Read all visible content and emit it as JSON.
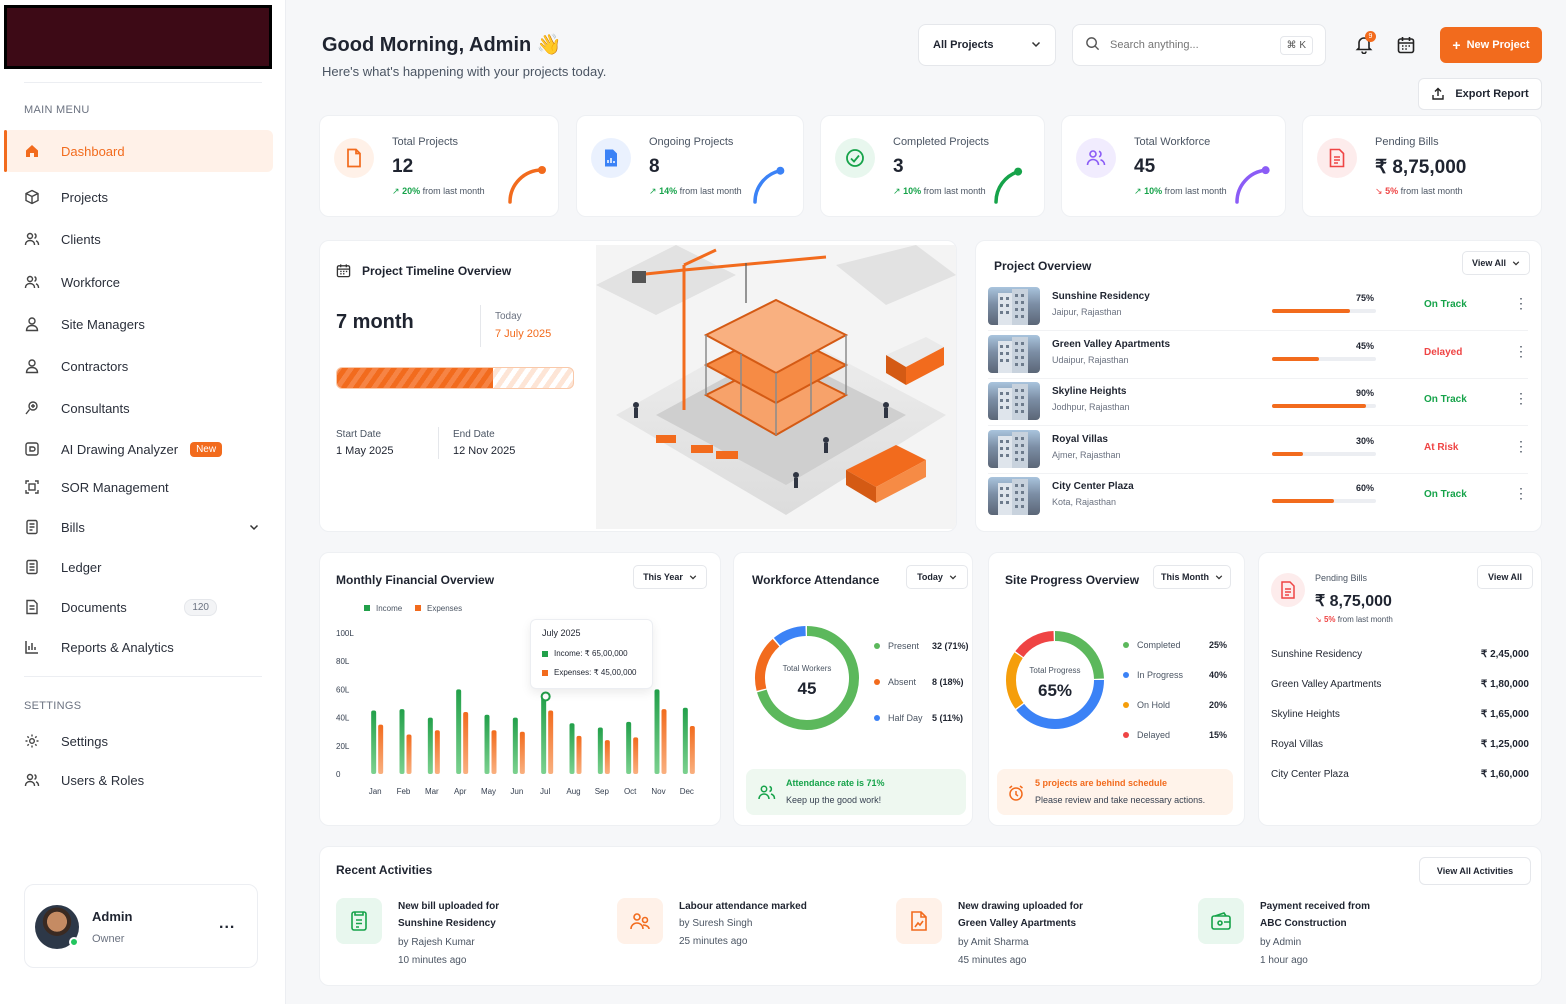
{
  "colors": {
    "accent": "#f26b1d",
    "green": "#16a34a",
    "red": "#ef4444",
    "blue": "#3b82f6",
    "purple": "#8b5cf6"
  },
  "sidebar": {
    "main_menu": "MAIN MENU",
    "settings_title": "SETTINGS",
    "items": [
      {
        "label": "Dashboard",
        "icon": "home-icon"
      },
      {
        "label": "Projects",
        "icon": "cube-icon"
      },
      {
        "label": "Clients",
        "icon": "users-icon"
      },
      {
        "label": "Workforce",
        "icon": "team-icon"
      },
      {
        "label": "Site Managers",
        "icon": "user-icon"
      },
      {
        "label": "Contractors",
        "icon": "user-icon"
      },
      {
        "label": "Consultants",
        "icon": "consultant-icon"
      },
      {
        "label": "AI Drawing Analyzer",
        "icon": "ai-icon",
        "badge": "New"
      },
      {
        "label": "SOR Management",
        "icon": "sor-icon"
      },
      {
        "label": "Bills",
        "icon": "bill-icon"
      },
      {
        "label": "Ledger",
        "icon": "ledger-icon"
      },
      {
        "label": "Documents",
        "icon": "document-icon",
        "count": "120"
      },
      {
        "label": "Reports & Analytics",
        "icon": "chart-icon"
      }
    ],
    "settings_items": [
      {
        "label": "Settings",
        "icon": "gear-icon"
      },
      {
        "label": "Users & Roles",
        "icon": "users-icon"
      }
    ],
    "user": {
      "name": "Admin",
      "role": "Owner",
      "more": "..."
    }
  },
  "header": {
    "greeting": "Good Morning, Admin 👋",
    "subtitle": "Here's what's happening with your projects today.",
    "project_select": "All Projects",
    "search_placeholder": "Search anything...",
    "search_shortcut": "⌘ K",
    "notif_count": "9",
    "new_project": "New Project",
    "export": "Export Report"
  },
  "kpis": [
    {
      "label": "Total Projects",
      "value": "12",
      "trend": "20%",
      "trend_text": "from last month",
      "dir": "up",
      "color": "#f26b1d",
      "bg": "#fff1e8",
      "icon": "file-icon",
      "arc": 0.75
    },
    {
      "label": "Ongoing Projects",
      "value": "8",
      "trend": "14%",
      "trend_text": "from last month",
      "dir": "up",
      "color": "#3b82f6",
      "bg": "#eaf1fe",
      "icon": "doc-chart-icon",
      "arc": 0.65
    },
    {
      "label": "Completed Projects",
      "value": "3",
      "trend": "10%",
      "trend_text": "from last month",
      "dir": "up",
      "color": "#16a34a",
      "bg": "#e8f7ee",
      "icon": "check-circle-icon",
      "arc": 0.6
    },
    {
      "label": "Total Workforce",
      "value": "45",
      "trend": "10%",
      "trend_text": "from last month",
      "dir": "up",
      "color": "#8b5cf6",
      "bg": "#f1ecfe",
      "icon": "people-icon",
      "arc": 0.7
    },
    {
      "label": "Pending Bills",
      "value": "₹ 8,75,000",
      "trend": "5%",
      "trend_text": "from last month",
      "dir": "down",
      "color": "#ef4444",
      "bg": "#fdecec",
      "icon": "invoice-icon",
      "arc": 0
    }
  ],
  "timeline": {
    "title": "Project Timeline Overview",
    "duration": "7 month",
    "today_label": "Today",
    "today_value": "7 July 2025",
    "progress": 0.66,
    "start_label": "Start Date",
    "start_value": "1 May 2025",
    "end_label": "End Date",
    "end_value": "12 Nov 2025"
  },
  "overview": {
    "title": "Project Overview",
    "view_all": "View All",
    "rows": [
      {
        "name": "Sunshine Residency",
        "loc": "Jaipur, Rajasthan",
        "pct": "75%",
        "val": 0.75,
        "status": "On Track",
        "scolor": "#16a34a"
      },
      {
        "name": "Green Valley Apartments",
        "loc": "Udaipur, Rajasthan",
        "pct": "45%",
        "val": 0.45,
        "status": "Delayed",
        "scolor": "#ef4444"
      },
      {
        "name": "Skyline Heights",
        "loc": "Jodhpur, Rajasthan",
        "pct": "90%",
        "val": 0.9,
        "status": "On Track",
        "scolor": "#16a34a"
      },
      {
        "name": "Royal Villas",
        "loc": "Ajmer, Rajasthan",
        "pct": "30%",
        "val": 0.3,
        "status": "At Risk",
        "scolor": "#ef4444"
      },
      {
        "name": "City Center Plaza",
        "loc": "Kota, Rajasthan",
        "pct": "60%",
        "val": 0.6,
        "status": "On Track",
        "scolor": "#16a34a"
      }
    ]
  },
  "finance": {
    "title": "Monthly Financial Overview",
    "period": "This Year",
    "tooltip": {
      "month": "July 2025",
      "income": "Income: ₹ 65,00,000",
      "expenses": "Expenses: ₹ 45,00,000"
    }
  },
  "chart_data": {
    "type": "bar",
    "categories": [
      "Jan",
      "Feb",
      "Mar",
      "Apr",
      "May",
      "Jun",
      "Jul",
      "Aug",
      "Sep",
      "Oct",
      "Nov",
      "Dec"
    ],
    "series": [
      {
        "name": "Income",
        "color": "#22a04a",
        "values": [
          45,
          46,
          40,
          60,
          42,
          40,
          55,
          36,
          33,
          37,
          60,
          47
        ]
      },
      {
        "name": "Expenses",
        "color": "#f26b1d",
        "values": [
          35,
          28,
          31,
          44,
          31,
          30,
          45,
          27,
          24,
          26,
          46,
          34
        ]
      }
    ],
    "yticks": [
      "100L",
      "80L",
      "60L",
      "40L",
      "20L",
      "0"
    ],
    "ylim": [
      0,
      100
    ],
    "legend": "top-left"
  },
  "attendance": {
    "title": "Workforce Attendance",
    "period": "Today",
    "center_label": "Total Workers",
    "center_value": "45",
    "items": [
      {
        "label": "Present",
        "value": "32 (71%)",
        "color": "#5cb85c",
        "frac": 0.71
      },
      {
        "label": "Absent",
        "value": "8 (18%)",
        "color": "#f26b1d",
        "frac": 0.18
      },
      {
        "label": "Half Day",
        "value": "5 (11%)",
        "color": "#3b82f6",
        "frac": 0.11
      }
    ],
    "alert_title": "Attendance rate is 71%",
    "alert_sub": "Keep up the good work!"
  },
  "site": {
    "title": "Site Progress Overview",
    "period": "This Month",
    "center_label": "Total Progress",
    "center_value": "65%",
    "items": [
      {
        "label": "Completed",
        "value": "25%",
        "color": "#5cb85c",
        "frac": 0.25
      },
      {
        "label": "In Progress",
        "value": "40%",
        "color": "#3b82f6",
        "frac": 0.4
      },
      {
        "label": "On Hold",
        "value": "20%",
        "color": "#f59e0b",
        "frac": 0.2
      },
      {
        "label": "Delayed",
        "value": "15%",
        "color": "#ef4444",
        "frac": 0.15
      }
    ],
    "alert_title": "5 projects are behind schedule",
    "alert_sub": "Please review and take necessary actions."
  },
  "bills": {
    "label": "Pending Bills",
    "value": "₹ 8,75,000",
    "trend": "5%",
    "trend_text": "from last month",
    "view_all": "View All",
    "rows": [
      {
        "name": "Sunshine Residency",
        "amount": "₹ 2,45,000"
      },
      {
        "name": "Green Valley Apartments",
        "amount": "₹ 1,80,000"
      },
      {
        "name": "Skyline Heights",
        "amount": "₹ 1,65,000"
      },
      {
        "name": "Royal Villas",
        "amount": "₹ 1,25,000"
      },
      {
        "name": "City Center Plaza",
        "amount": "₹ 1,60,000"
      }
    ]
  },
  "activities": {
    "title": "Recent Activities",
    "view_all": "View All Activities",
    "items": [
      {
        "l1": "New bill uploaded for",
        "l2": "Sunshine Residency",
        "by": "by Rajesh Kumar",
        "time": "10 minutes ago",
        "icon": "bill-upload-icon",
        "color": "#16a34a",
        "bg": "#e8f7ee"
      },
      {
        "l1": "Labour attendance marked",
        "l2": "",
        "by": "by Suresh Singh",
        "time": "25 minutes ago",
        "icon": "labour-icon",
        "color": "#f26b1d",
        "bg": "#fff1e8"
      },
      {
        "l1": "New drawing uploaded for",
        "l2": "Green Valley Apartments",
        "by": "by Amit Sharma",
        "time": "45 minutes ago",
        "icon": "drawing-icon",
        "color": "#f26b1d",
        "bg": "#fff1e8"
      },
      {
        "l1": "Payment received from",
        "l2": "ABC Construction",
        "by": "by Admin",
        "time": "1 hour ago",
        "icon": "payment-icon",
        "color": "#16a34a",
        "bg": "#e8f7ee"
      }
    ]
  }
}
